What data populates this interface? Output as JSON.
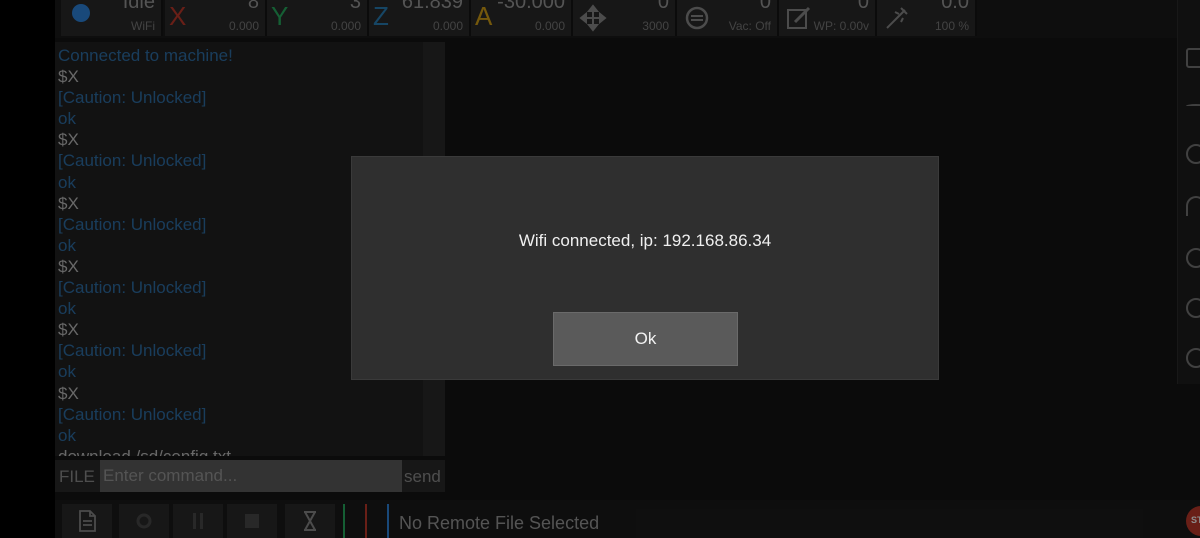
{
  "topbar": {
    "state": {
      "value": "Idle",
      "conn": "WiFi"
    },
    "x": {
      "letter": "X",
      "value": "8",
      "work": "0.000",
      "color": "#c0392b"
    },
    "y": {
      "letter": "Y",
      "value": "3",
      "work": "0.000",
      "color": "#27ae60"
    },
    "z": {
      "letter": "Z",
      "value": "61.839",
      "work": "0.000",
      "color": "#2980b9"
    },
    "a": {
      "letter": "A",
      "value": "-30.000",
      "work": "0.000",
      "color": "#d4a017"
    },
    "jog": {
      "value": "0",
      "sub": "3000"
    },
    "vac": {
      "value": "0",
      "sub": "Vac: Off"
    },
    "wp": {
      "value": "0",
      "sub": "WP: 0.00v"
    },
    "override": {
      "value": "0.0",
      "sub": "100 %"
    }
  },
  "console": {
    "lines": [
      {
        "text": "Connected to machine!",
        "type": "info"
      },
      {
        "text": "$X",
        "type": "cmd"
      },
      {
        "text": "[Caution: Unlocked]",
        "type": "resp"
      },
      {
        "text": "ok",
        "type": "resp"
      },
      {
        "text": "$X",
        "type": "cmd"
      },
      {
        "text": "[Caution: Unlocked]",
        "type": "resp"
      },
      {
        "text": "ok",
        "type": "resp"
      },
      {
        "text": "$X",
        "type": "cmd"
      },
      {
        "text": "[Caution: Unlocked]",
        "type": "resp"
      },
      {
        "text": "ok",
        "type": "resp"
      },
      {
        "text": "$X",
        "type": "cmd"
      },
      {
        "text": "[Caution: Unlocked]",
        "type": "resp"
      },
      {
        "text": "ok",
        "type": "resp"
      },
      {
        "text": "$X",
        "type": "cmd"
      },
      {
        "text": "[Caution: Unlocked]",
        "type": "resp"
      },
      {
        "text": "ok",
        "type": "resp"
      },
      {
        "text": "$X",
        "type": "cmd"
      },
      {
        "text": "[Caution: Unlocked]",
        "type": "resp"
      },
      {
        "text": "ok",
        "type": "resp"
      },
      {
        "text": "download /sd/config.txt",
        "type": "cmd"
      }
    ],
    "colors": {
      "info": "#2f6fa8",
      "cmd": "#bdbdbd",
      "resp": "#2f6fa8"
    }
  },
  "command": {
    "file_label": "FILE",
    "placeholder": "Enter command...",
    "send_label": "send"
  },
  "bottombar": {
    "status": "No Remote File Selected"
  },
  "stop": {
    "label": "STOP"
  },
  "dialog": {
    "message": "Wifi connected, ip: 192.168.86.34",
    "ok_label": "Ok"
  }
}
